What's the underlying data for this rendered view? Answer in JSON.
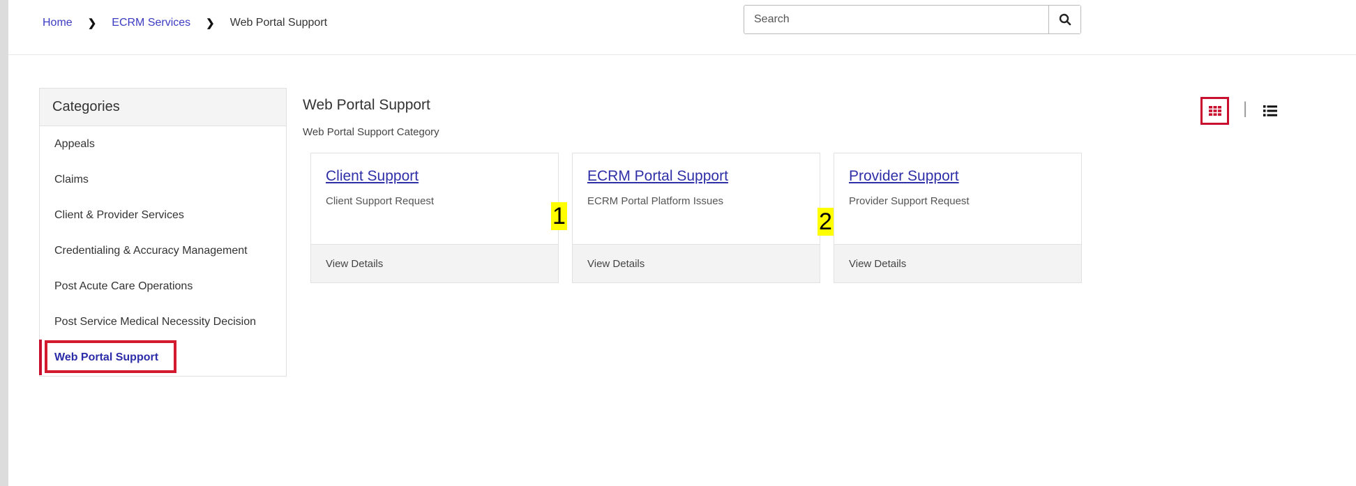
{
  "breadcrumb": {
    "items": [
      {
        "label": "Home",
        "link": true
      },
      {
        "label": "ECRM Services",
        "link": true
      },
      {
        "label": "Web Portal Support",
        "link": false
      }
    ]
  },
  "search": {
    "placeholder": "Search",
    "value": ""
  },
  "sidebar": {
    "header": "Categories",
    "items": [
      {
        "label": "Appeals"
      },
      {
        "label": "Claims"
      },
      {
        "label": "Client & Provider Services"
      },
      {
        "label": "Credentialing & Accuracy Management"
      },
      {
        "label": "Post Acute Care Operations"
      },
      {
        "label": "Post Service Medical Necessity Decision"
      },
      {
        "label": "Web Portal Support",
        "active": true
      }
    ]
  },
  "main": {
    "title": "Web Portal Support",
    "subtitle": "Web Portal Support Category",
    "view_toggle": {
      "grid_icon": "grid-view-icon",
      "list_icon": "list-view-icon",
      "selected": "grid",
      "divider": "|"
    },
    "cards": [
      {
        "title": "Client Support",
        "description": "Client Support Request",
        "footer": "View Details"
      },
      {
        "title": "ECRM Portal Support",
        "description": "ECRM Portal Platform Issues",
        "footer": "View Details"
      },
      {
        "title": "Provider Support",
        "description": "Provider Support Request",
        "footer": "View Details"
      }
    ]
  },
  "annotations": {
    "marker_1": "1",
    "marker_2": "2"
  },
  "colors": {
    "link": "#2f2fa8",
    "highlight_border": "#d41a2e",
    "marker_bg": "#ffff00"
  }
}
